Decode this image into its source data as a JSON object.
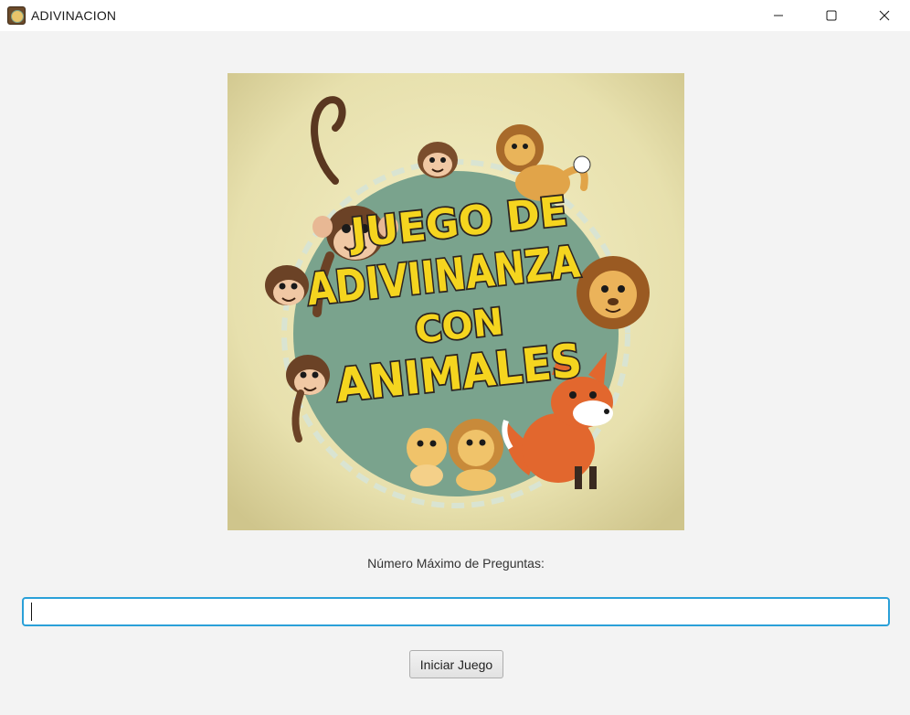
{
  "window": {
    "title": "ADIVINACION",
    "icon": "app-icon",
    "controls": [
      "minimize-icon",
      "maximize-icon",
      "close-icon"
    ]
  },
  "cover": {
    "line1": "JUEGO DE",
    "line2": "ADIVIINANZA",
    "line3": "CON",
    "line4": "ANIMALES",
    "colors": {
      "background": "#ece6b3",
      "circle": "#7aa38d",
      "text_fill": "#f5d51f",
      "text_outline": "#2b2320"
    },
    "animals": [
      "monkey",
      "monkey",
      "monkey",
      "monkey",
      "lion",
      "lion",
      "lion",
      "lion-cub",
      "fox"
    ]
  },
  "form": {
    "label": "Número Máximo de Preguntas:",
    "input_value": "",
    "input_placeholder": "",
    "button_label": "Iniciar Juego"
  },
  "colors": {
    "window_bg": "#f3f3f3",
    "focus_border": "#2aa0d8"
  }
}
